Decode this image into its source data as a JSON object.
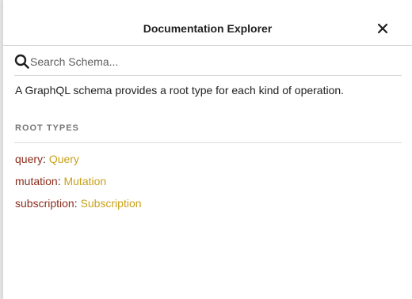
{
  "header": {
    "title": "Documentation Explorer",
    "close_icon": "close-icon"
  },
  "search": {
    "icon": "search-icon",
    "placeholder": "Search Schema...",
    "value": ""
  },
  "description": "A GraphQL schema provides a root type for each kind of operation.",
  "root_types": {
    "title": "ROOT TYPES",
    "items": [
      {
        "field": "query",
        "separator": ": ",
        "type": "Query"
      },
      {
        "field": "mutation",
        "separator": ": ",
        "type": "Mutation"
      },
      {
        "field": "subscription",
        "separator": ": ",
        "type": "Subscription"
      }
    ]
  },
  "colors": {
    "field_name": "#8b2c1c",
    "type_name": "#c9a11c",
    "section_title": "#777777",
    "divider": "#d8d8d8"
  }
}
